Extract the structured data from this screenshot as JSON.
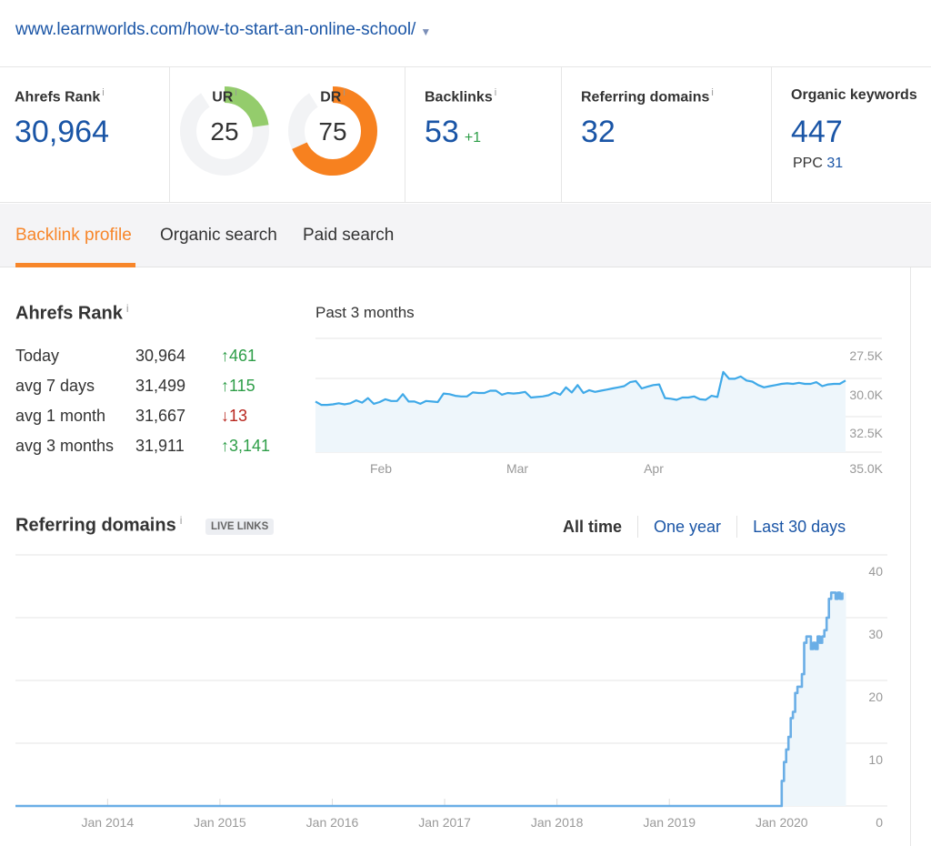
{
  "header": {
    "url": "www.learnworlds.com/how-to-start-an-online-school/",
    "url_dropdown_icon": "caret-down-icon"
  },
  "metrics": {
    "ahrefs_rank": {
      "label": "Ahrefs Rank",
      "info_icon": "i",
      "value": "30,964"
    },
    "ur": {
      "label": "UR",
      "info_icon": "i",
      "value": "25",
      "score": 25,
      "color": "#94cc6c"
    },
    "dr": {
      "label": "DR",
      "info_icon": "i",
      "value": "75",
      "score": 75,
      "color": "#f7811f"
    },
    "backlinks": {
      "label": "Backlinks",
      "info_icon": "i",
      "value": "53",
      "delta": "+1"
    },
    "referring_domains": {
      "label": "Referring domains",
      "info_icon": "i",
      "value": "32"
    },
    "organic_keywords": {
      "label": "Organic keywords",
      "value": "447",
      "ppc_label": "PPC",
      "ppc_value": "31"
    }
  },
  "tabs": [
    {
      "label": "Backlink profile",
      "active": true
    },
    {
      "label": "Organic search",
      "active": false
    },
    {
      "label": "Paid search",
      "active": false
    }
  ],
  "ahrefs_rank_section": {
    "title": "Ahrefs Rank",
    "info_icon": "i",
    "rows": [
      {
        "period": "Today",
        "value": "30,964",
        "direction": "up",
        "arrow": "↑",
        "change": "461"
      },
      {
        "period": "avg 7 days",
        "value": "31,499",
        "direction": "up",
        "arrow": "↑",
        "change": "115"
      },
      {
        "period": "avg 1 month",
        "value": "31,667",
        "direction": "down",
        "arrow": "↓",
        "change": "13"
      },
      {
        "period": "avg 3 months",
        "value": "31,911",
        "direction": "up",
        "arrow": "↑",
        "change": "3,141"
      }
    ],
    "chart_label": "Past 3 months"
  },
  "referring_domains_section": {
    "title": "Referring domains",
    "info_icon": "i",
    "badge": "LIVE LINKS",
    "ranges": [
      {
        "label": "All time",
        "active": true
      },
      {
        "label": "One year",
        "active": false
      },
      {
        "label": "Last 30 days",
        "active": false
      }
    ]
  },
  "chart_data": [
    {
      "type": "area",
      "title": "Past 3 months",
      "name": "ahrefs-rank-3-months",
      "x_ticks": [
        "Feb",
        "Mar",
        "Apr"
      ],
      "y_ticks": [
        "27.5K",
        "30.0K",
        "32.5K",
        "35.0K"
      ],
      "y_tick_values": [
        27500,
        30000,
        32500,
        35000
      ],
      "y_inverted": true,
      "ylim": [
        26250,
        36250
      ],
      "grid": true,
      "line_color": "#3fa9e8",
      "fill_color": "#eef6fb",
      "values": [
        31800,
        32100,
        32100,
        32050,
        31950,
        32050,
        31950,
        31700,
        31900,
        31500,
        32000,
        31850,
        31600,
        31750,
        31750,
        31150,
        31800,
        31800,
        32000,
        31750,
        31800,
        31850,
        31100,
        31150,
        31300,
        31350,
        31350,
        31000,
        31050,
        31050,
        30850,
        30850,
        31200,
        31050,
        31100,
        31050,
        30950,
        31450,
        31400,
        31350,
        31250,
        31000,
        31200,
        30550,
        31000,
        30350,
        31050,
        30800,
        30950,
        30850,
        30750,
        30650,
        30550,
        30450,
        30100,
        30000,
        30650,
        30500,
        30350,
        30300,
        31500,
        31550,
        31650,
        31450,
        31450,
        31350,
        31600,
        31650,
        31300,
        31400,
        29200,
        29800,
        29800,
        29600,
        29950,
        30050,
        30350,
        30550,
        30450,
        30350,
        30250,
        30200,
        30250,
        30150,
        30250,
        30250,
        30100,
        30450,
        30300,
        30250,
        30250,
        29950
      ]
    },
    {
      "type": "area",
      "title": "Referring domains",
      "name": "referring-domains-all-time",
      "x_ticks": [
        "Jan 2014",
        "Jan 2015",
        "Jan 2016",
        "Jan 2017",
        "Jan 2018",
        "Jan 2019",
        "Jan 2020"
      ],
      "x_tick_values": [
        2014,
        2015,
        2016,
        2017,
        2018,
        2019,
        2020
      ],
      "xlim": [
        2013.18,
        2020.73
      ],
      "y_ticks": [
        "0",
        "10",
        "20",
        "30",
        "40"
      ],
      "y_tick_values": [
        0,
        10,
        20,
        30,
        40
      ],
      "ylim": [
        0,
        40
      ],
      "grid": true,
      "line_color": "#6aaee6",
      "fill_color": "#eef6fb",
      "x": [
        2013.18,
        2019.98,
        2020.0,
        2020.02,
        2020.04,
        2020.06,
        2020.08,
        2020.1,
        2020.12,
        2020.14,
        2020.16,
        2020.18,
        2020.2,
        2020.22,
        2020.24,
        2020.26,
        2020.28,
        2020.3,
        2020.32,
        2020.34,
        2020.36,
        2020.38,
        2020.4,
        2020.42,
        2020.44,
        2020.46,
        2020.48,
        2020.5,
        2020.52,
        2020.54
      ],
      "values": [
        0,
        0,
        4,
        7,
        9,
        11,
        14,
        15,
        18,
        19,
        19,
        21,
        26,
        27,
        27,
        25,
        26,
        25,
        27,
        26,
        27,
        28,
        30,
        33,
        34,
        34,
        33,
        34,
        33,
        34
      ]
    }
  ]
}
